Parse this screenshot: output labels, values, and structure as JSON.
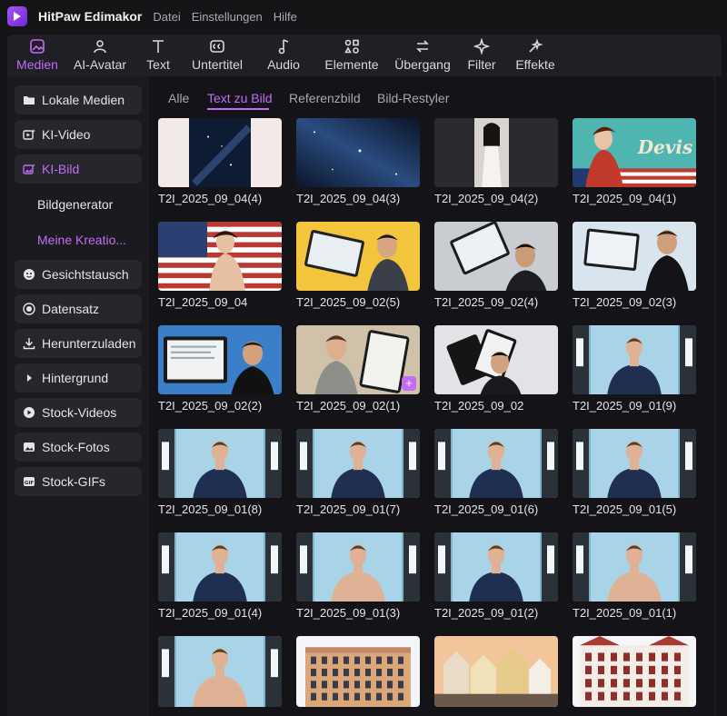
{
  "app": {
    "title": "HitPaw Edimakor",
    "menu": [
      "Datei",
      "Einstellungen",
      "Hilfe"
    ]
  },
  "toolbar": [
    {
      "label": "Medien",
      "icon": "media-icon",
      "active": true
    },
    {
      "label": "AI-Avatar",
      "icon": "avatar-icon",
      "active": false
    },
    {
      "label": "Text",
      "icon": "text-icon",
      "active": false
    },
    {
      "label": "Untertitel",
      "icon": "subtitles-icon",
      "active": false
    },
    {
      "label": "Audio",
      "icon": "audio-icon",
      "active": false
    },
    {
      "label": "Elemente",
      "icon": "elements-icon",
      "active": false
    },
    {
      "label": "Übergang",
      "icon": "transition-icon",
      "active": false
    },
    {
      "label": "Filter",
      "icon": "filter-icon",
      "active": false
    },
    {
      "label": "Effekte",
      "icon": "effects-icon",
      "active": false
    }
  ],
  "sidebar": {
    "items": [
      {
        "label": "Lokale Medien",
        "icon": "folder-icon"
      },
      {
        "label": "KI-Video",
        "icon": "ai-video-icon"
      },
      {
        "label": "KI-Bild",
        "icon": "ai-image-icon",
        "active": true
      },
      {
        "label": "Gesichtstausch",
        "icon": "face-swap-icon"
      },
      {
        "label": "Datensatz",
        "icon": "dataset-icon"
      },
      {
        "label": "Herunterzuladen",
        "icon": "download-icon"
      },
      {
        "label": "Hintergrund",
        "icon": "background-icon"
      },
      {
        "label": "Stock-Videos",
        "icon": "stock-video-icon"
      },
      {
        "label": "Stock-Fotos",
        "icon": "stock-photo-icon"
      },
      {
        "label": "Stock-GIFs",
        "icon": "gif-icon"
      }
    ],
    "subitems": [
      {
        "label": "Bildgenerator"
      },
      {
        "label": "Meine Kreatio...",
        "active": true
      }
    ]
  },
  "tabs": [
    {
      "label": "Alle"
    },
    {
      "label": "Text zu Bild",
      "active": true
    },
    {
      "label": "Referenzbild"
    },
    {
      "label": "Bild-Restyler"
    }
  ],
  "thumbnails": [
    {
      "label": "T2I_2025_09_04(4)",
      "kind": "space-narrow"
    },
    {
      "label": "T2I_2025_09_04(3)",
      "kind": "space-wide"
    },
    {
      "label": "T2I_2025_09_04(2)",
      "kind": "woman-dress"
    },
    {
      "label": "T2I_2025_09_04(1)",
      "kind": "pinup-devis"
    },
    {
      "label": "T2I_2025_09_04",
      "kind": "pinup-flag"
    },
    {
      "label": "T2I_2025_09_02(5)",
      "kind": "tablet-yellow"
    },
    {
      "label": "T2I_2025_09_02(4)",
      "kind": "tablet-grey"
    },
    {
      "label": "T2I_2025_09_02(3)",
      "kind": "tablet-blue"
    },
    {
      "label": "T2I_2025_09_02(2)",
      "kind": "tablet-blue2"
    },
    {
      "label": "T2I_2025_09_02(1)",
      "kind": "tablet-beige",
      "badge": "+"
    },
    {
      "label": "T2I_2025_09_02",
      "kind": "tablet-dark"
    },
    {
      "label": "T2I_2025_09_01(9)",
      "kind": "studio"
    },
    {
      "label": "T2I_2025_09_01(8)",
      "kind": "studio"
    },
    {
      "label": "T2I_2025_09_01(7)",
      "kind": "studio"
    },
    {
      "label": "T2I_2025_09_01(6)",
      "kind": "studio"
    },
    {
      "label": "T2I_2025_09_01(5)",
      "kind": "studio"
    },
    {
      "label": "T2I_2025_09_01(4)",
      "kind": "studio"
    },
    {
      "label": "T2I_2025_09_01(3)",
      "kind": "studio-shirtless"
    },
    {
      "label": "T2I_2025_09_01(2)",
      "kind": "studio"
    },
    {
      "label": "T2I_2025_09_01(1)",
      "kind": "studio-shirtless"
    },
    {
      "label": "",
      "kind": "studio-shirtless"
    },
    {
      "label": "",
      "kind": "building"
    },
    {
      "label": "",
      "kind": "town-houses"
    },
    {
      "label": "",
      "kind": "building-red"
    }
  ],
  "colors": {
    "accent": "#c36cf5",
    "panel": "#1f1f25",
    "background": "#141418"
  }
}
